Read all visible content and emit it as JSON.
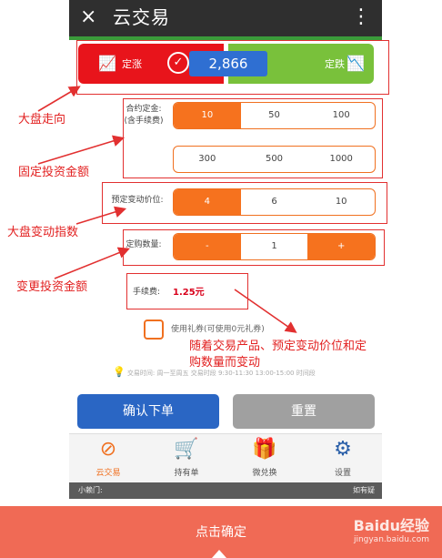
{
  "app": {
    "title": "云交易",
    "close_icon": "×",
    "more_icon": "⋮"
  },
  "market": {
    "up_label": "定涨",
    "down_label": "定跌",
    "index_value": "2,866",
    "up_color": "#e8141b",
    "down_color": "#79c13b"
  },
  "contract": {
    "label_line1": "合约定金:",
    "label_line2": "(含手续费)",
    "options": [
      "10",
      "50",
      "100",
      "300",
      "500",
      "1000"
    ],
    "selected": "10"
  },
  "change_point": {
    "label": "预定变动价位:",
    "options": [
      "4",
      "6",
      "10"
    ],
    "selected": "4"
  },
  "quantity": {
    "label": "定购数量:",
    "minus": "-",
    "value": "1",
    "plus": "+"
  },
  "fee": {
    "label": "手续费:",
    "value": "1.25元"
  },
  "coupon": {
    "label": "使用礼券(可使用0元礼券)"
  },
  "hint": {
    "text": "交易时间: 周一至周五 交易时段 9:30-11:30 13:00-15:00 时间段"
  },
  "actions": {
    "confirm": "确认下单",
    "reset": "重置"
  },
  "tabs": [
    {
      "label": "云交易",
      "icon": "⊘",
      "active": true
    },
    {
      "label": "持有单",
      "icon": "🛒",
      "active": false
    },
    {
      "label": "微兑换",
      "icon": "🎁",
      "active": false
    },
    {
      "label": "设置",
      "icon": "⚙",
      "active": false
    }
  ],
  "ticker": {
    "left": "小赖门:",
    "right": "如有疑"
  },
  "annotations": {
    "trend": "大盘走向",
    "fixed_amount": "固定投资金额",
    "index_change": "大盘变动指数",
    "change_amount": "变更投资金额",
    "note_line1": "随着交易产品、预定变动价位和定",
    "note_line2": "购数量而变动"
  },
  "banner": {
    "text": "点击确定",
    "watermark": "Baidu经验",
    "watermark_url": "jingyan.baidu.com"
  }
}
